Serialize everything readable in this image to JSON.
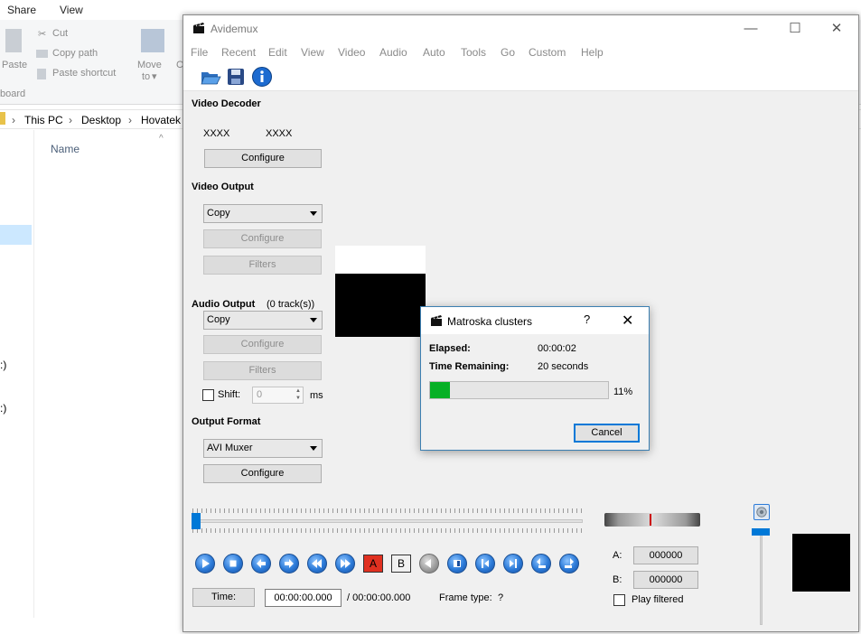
{
  "explorer": {
    "tabs": [
      "Share",
      "View"
    ],
    "ribbon": {
      "paste": "Paste",
      "cut": "Cut",
      "copy_path": "Copy path",
      "paste_shortcut": "Paste shortcut",
      "move_to": "Move",
      "move_to_sub": "to",
      "clipboard_group": "board",
      "copy_to_partial": "C"
    },
    "address": [
      "This PC",
      "Desktop",
      "Hovatek"
    ],
    "column_name": "Name",
    "nav_drive_labels": [
      ":)",
      ":)"
    ]
  },
  "app": {
    "title": "Avidemux",
    "menu": [
      "File",
      "Recent",
      "Edit",
      "View",
      "Video",
      "Audio",
      "Auto",
      "Tools",
      "Go",
      "Custom",
      "Help"
    ],
    "video_decoder": {
      "title": "Video Decoder",
      "codec_a": "XXXX",
      "codec_b": "XXXX",
      "configure": "Configure"
    },
    "video_output": {
      "title": "Video Output",
      "selected": "Copy",
      "configure": "Configure",
      "filters": "Filters"
    },
    "audio_output": {
      "title": "Audio Output",
      "tracks": "(0 track(s))",
      "selected": "Copy",
      "configure": "Configure",
      "filters": "Filters",
      "shift_label": "Shift:",
      "shift_value": "0",
      "shift_unit": "ms"
    },
    "output_format": {
      "title": "Output Format",
      "selected": "AVI Muxer",
      "configure": "Configure"
    },
    "navigation": {
      "marker_a": "A",
      "marker_b": "B"
    },
    "time": {
      "button": "Time:",
      "current": "00:00:00.000",
      "total": "/ 00:00:00.000",
      "frame_type_label": "Frame type:",
      "frame_type_value": "?"
    },
    "ab": {
      "a_label": "A:",
      "a_value": "000000",
      "b_label": "B:",
      "b_value": "000000",
      "play_filtered": "Play filtered"
    }
  },
  "dialog": {
    "title": "Matroska clusters",
    "help": "?",
    "close": "✕",
    "elapsed_label": "Elapsed:",
    "elapsed_value": "00:00:02",
    "remaining_label": "Time Remaining:",
    "remaining_value": "20 seconds",
    "progress_fraction": 0.11,
    "progress_text": "11%",
    "cancel": "Cancel",
    "progress_color": "#06b025"
  }
}
